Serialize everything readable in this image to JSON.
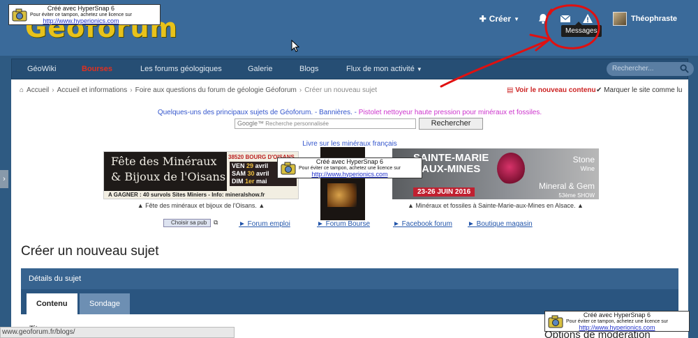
{
  "header": {
    "logo_text": "Géoforum",
    "create_label": "Créer",
    "username": "Théophraste",
    "tooltip": "Messages"
  },
  "nav": {
    "tabs": [
      {
        "label": "GéoWiki",
        "active": false
      },
      {
        "label": "Bourses",
        "active": true
      },
      {
        "label": "Les forums géologiques",
        "active": false
      },
      {
        "label": "Galerie",
        "active": false
      },
      {
        "label": "Blogs",
        "active": false
      },
      {
        "label": "Flux de mon activité",
        "active": false
      }
    ],
    "search_placeholder": "Rechercher..."
  },
  "breadcrumb": {
    "items": [
      "Accueil",
      "Accueil et informations",
      "Foire aux questions du forum de géologie Géoforum",
      "Créer un nouveau sujet"
    ],
    "new_content": "Voir le nouveau contenu",
    "mark_read": "Marquer le site comme lu"
  },
  "promo": {
    "text_prefix": "Quelques-uns des principaux sujets de Géoforum. - ",
    "banners_link": "Bannières.",
    "text_mid": " - ",
    "pink_text": "Pistolet nettoyeur haute pression pour minéraux et fossiles.",
    "google_placeholder": "Recherche personnalisée",
    "google_brand": "Google™",
    "search_button": "Rechercher",
    "livre": "Livre sur les minéraux français"
  },
  "banners": {
    "left": {
      "line1": "Fête des Minéraux",
      "line2": "& Bijoux de l'Oisans",
      "agagner": "A GAGNER : 40 survols Sites Miniers - Info: mineralshow.fr",
      "town": "38520 BOURG D'OISANS",
      "d1": "VEN",
      "n1": "29",
      "m1": "avril",
      "d2": "SAM",
      "n2": "30",
      "m2": "avril",
      "d3": "DIM",
      "n3": "1er",
      "m3": "mai",
      "caption": "▲ Fête des minéraux et bijoux de l'Oisans. ▲"
    },
    "right": {
      "title1": "SAINTE-MARIE",
      "title2": "AUX-MINES",
      "dates": "23-26 JUIN 2016",
      "stone": "Stone",
      "wine": "Wine",
      "mg": "Mineral & Gem",
      "show": "53ème SHOW",
      "caption": "▲ Minéraux et fossiles à Sainte-Marie-aux-Mines en Alsace. ▲"
    }
  },
  "links": {
    "choisir": "Choisir sa pub",
    "items": [
      "► Forum emploi",
      "► Forum Bourse",
      "► Facebook forum",
      "► Boutique magasin"
    ]
  },
  "form": {
    "page_title": "Créer un nouveau sujet",
    "details": "Détails du sujet",
    "tab_content": "Contenu",
    "tab_poll": "Sondage",
    "titre": "Titre",
    "options": "Options de modération"
  },
  "status_url": "www.geoforum.fr/blogs/",
  "stamp": {
    "line1": "Créé avec HyperSnap 6",
    "line2": "Pour éviter ce tampon, achetez une licence sur",
    "line3": "http://www.hyperionics.com"
  },
  "colors": {
    "header_bg": "#3a6a9a",
    "nav_bg": "#264e74",
    "active_tab": "#e03020",
    "annotation": "#e01010"
  }
}
